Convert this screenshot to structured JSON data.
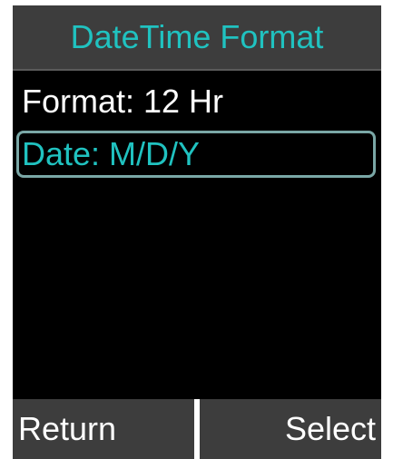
{
  "header": {
    "title": "DateTime Format"
  },
  "menu": {
    "items": [
      {
        "label": "Format: 12 Hr",
        "selected": false
      },
      {
        "label": "Date: M/D/Y",
        "selected": true
      }
    ]
  },
  "softkeys": {
    "left_label": "Return",
    "right_label": "Select"
  },
  "colors": {
    "accent": "#20c2c0",
    "bar_background": "#3d3d3d",
    "content_background": "#000000",
    "text": "#ffffff"
  }
}
